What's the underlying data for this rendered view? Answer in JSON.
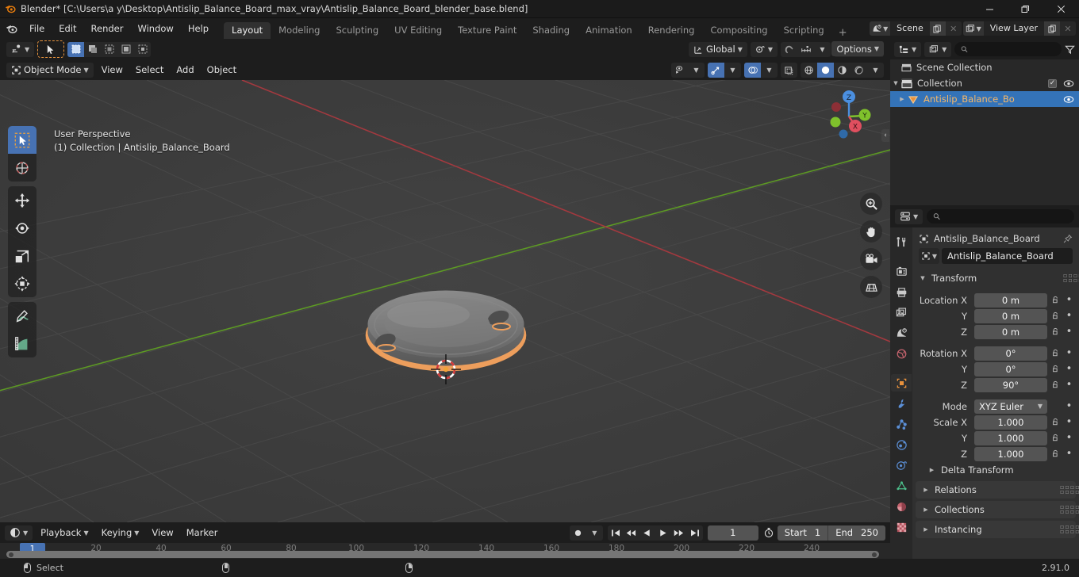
{
  "window": {
    "title": "Blender* [C:\\Users\\a y\\Desktop\\Antislip_Balance_Board_max_vray\\Antislip_Balance_Board_blender_base.blend]",
    "minimize": "—",
    "maximize": "❐",
    "close": "✕"
  },
  "topbar": {
    "menus": [
      "File",
      "Edit",
      "Render",
      "Window",
      "Help"
    ],
    "workspaces": [
      "Layout",
      "Modeling",
      "Sculpting",
      "UV Editing",
      "Texture Paint",
      "Shading",
      "Animation",
      "Rendering",
      "Compositing",
      "Scripting"
    ],
    "active_workspace": "Layout",
    "add_workspace": "+",
    "scene_name": "Scene",
    "view_layer_name": "View Layer"
  },
  "viewport": {
    "mode": "Object Mode",
    "menus": [
      "View",
      "Select",
      "Add",
      "Object"
    ],
    "transform_orientation": "Global",
    "options_label": "Options",
    "overlay_line1": "User Perspective",
    "overlay_line2": "(1) Collection | Antislip_Balance_Board",
    "gizmo_axes": [
      "X",
      "Y",
      "Z"
    ]
  },
  "outliner": {
    "search_placeholder": "",
    "rows": [
      {
        "name": "Scene Collection",
        "depth": 0,
        "icon": "collection-icon",
        "expandable": false,
        "checkbox": false,
        "eye": false,
        "selected": false
      },
      {
        "name": "Collection",
        "depth": 1,
        "icon": "collection-icon",
        "expandable": true,
        "checkbox": true,
        "eye": true,
        "selected": false
      },
      {
        "name": "Antislip_Balance_Bo",
        "depth": 2,
        "icon": "mesh-data-icon",
        "expandable": true,
        "checkbox": false,
        "eye": true,
        "selected": true
      }
    ]
  },
  "properties": {
    "search_placeholder": "",
    "breadcrumb": "Antislip_Balance_Board",
    "object_name": "Antislip_Balance_Board",
    "tabs": [
      "tool-icon",
      "render-icon",
      "output-icon",
      "view-layer-icon",
      "scene-icon",
      "world-icon",
      "object-icon",
      "modifier-icon",
      "particles-icon",
      "physics-icon",
      "constraint-icon",
      "data-icon",
      "material-icon",
      "texture-icon"
    ],
    "active_tab": "object-icon",
    "transform": {
      "title": "Transform",
      "rows": [
        {
          "label": "Location X",
          "value": "0 m"
        },
        {
          "label": "Y",
          "value": "0 m"
        },
        {
          "label": "Z",
          "value": "0 m"
        },
        {
          "label": "Rotation X",
          "value": "0°"
        },
        {
          "label": "Y",
          "value": "0°"
        },
        {
          "label": "Z",
          "value": "90°"
        }
      ],
      "mode_label": "Mode",
      "mode_value": "XYZ Euler",
      "scale_rows": [
        {
          "label": "Scale X",
          "value": "1.000"
        },
        {
          "label": "Y",
          "value": "1.000"
        },
        {
          "label": "Z",
          "value": "1.000"
        }
      ],
      "delta_transform": "Delta Transform"
    },
    "panels": [
      "Relations",
      "Collections",
      "Instancing"
    ]
  },
  "timeline": {
    "menus": [
      "Playback",
      "Keying",
      "View",
      "Marker"
    ],
    "current_frame": "1",
    "start_label": "Start",
    "start_value": "1",
    "end_label": "End",
    "end_value": "250",
    "ticks": [
      {
        "label": "20",
        "frame": 20
      },
      {
        "label": "40",
        "frame": 40
      },
      {
        "label": "60",
        "frame": 60
      },
      {
        "label": "80",
        "frame": 80
      },
      {
        "label": "100",
        "frame": 100
      },
      {
        "label": "120",
        "frame": 120
      },
      {
        "label": "140",
        "frame": 140
      },
      {
        "label": "160",
        "frame": 160
      },
      {
        "label": "180",
        "frame": 180
      },
      {
        "label": "200",
        "frame": 200
      },
      {
        "label": "220",
        "frame": 220
      },
      {
        "label": "240",
        "frame": 240
      }
    ],
    "playhead_label": "1"
  },
  "statusbar": {
    "select_label": "Select",
    "version": "2.91.0"
  },
  "colors": {
    "accent_blue": "#4772b3",
    "selection_orange": "#ed9e5c",
    "axis_x_red": "#cf4444",
    "axis_y_green": "#7ab51d",
    "bg_dark": "#1d1d1d",
    "bg_panel": "#303030",
    "bg_viewport": "#3b3b3b"
  }
}
